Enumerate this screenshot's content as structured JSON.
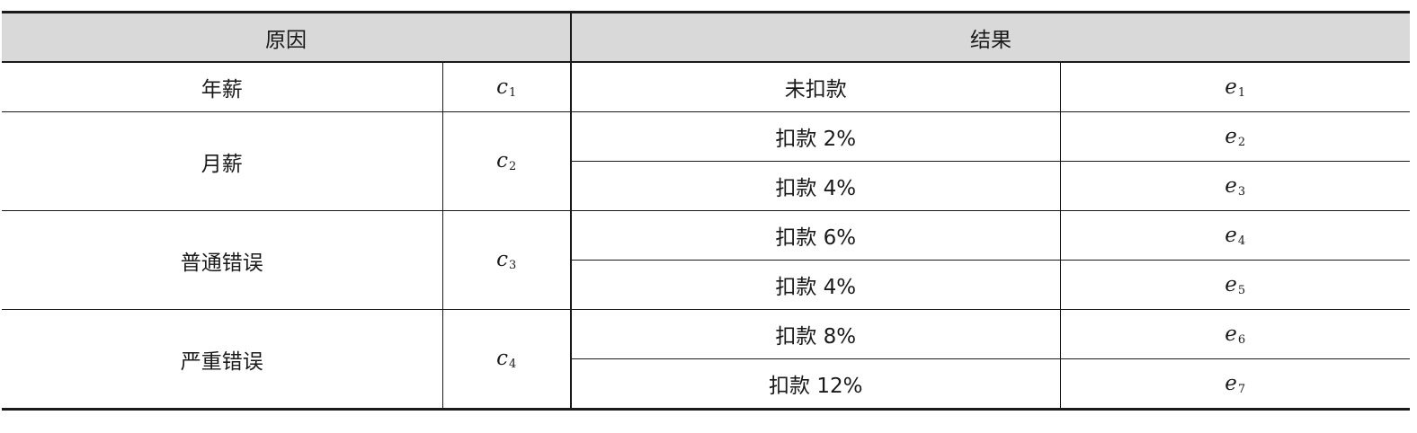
{
  "header": {
    "cause": "原因",
    "effect": "结果"
  },
  "causes": [
    {
      "label": "年薪",
      "symbol": "c",
      "sub": "1"
    },
    {
      "label": "月薪",
      "symbol": "c",
      "sub": "2"
    },
    {
      "label": "普通错误",
      "symbol": "c",
      "sub": "3"
    },
    {
      "label": "严重错误",
      "symbol": "c",
      "sub": "4"
    }
  ],
  "effects": [
    {
      "label": "未扣款",
      "symbol": "e",
      "sub": "1"
    },
    {
      "label": "扣款 2%",
      "symbol": "e",
      "sub": "2"
    },
    {
      "label": "扣款 4%",
      "symbol": "e",
      "sub": "3"
    },
    {
      "label": "扣款 6%",
      "symbol": "e",
      "sub": "4"
    },
    {
      "label": "扣款 4%",
      "symbol": "e",
      "sub": "5"
    },
    {
      "label": "扣款 8%",
      "symbol": "e",
      "sub": "6"
    },
    {
      "label": "扣款 12%",
      "symbol": "e",
      "sub": "7"
    }
  ]
}
